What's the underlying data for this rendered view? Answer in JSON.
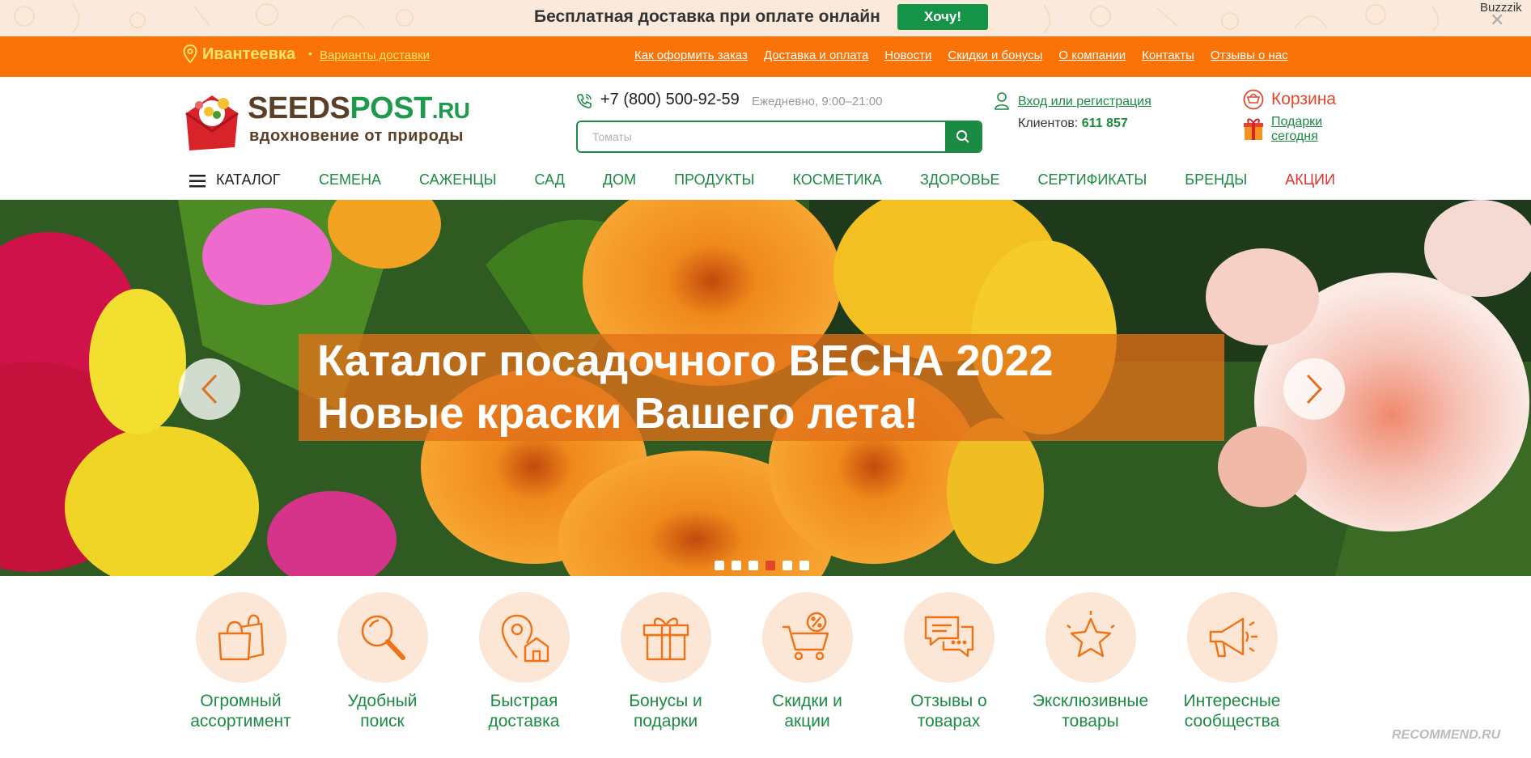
{
  "promo": {
    "text": "Бесплатная доставка при оплате онлайн",
    "button": "Хочу!",
    "corner_label": "Buzzzik"
  },
  "topbar": {
    "city": "Ивантеевка",
    "delivery_link": "Варианты доставки",
    "links": [
      "Как оформить заказ",
      "Доставка и оплата",
      "Новости",
      "Скидки и бонусы",
      "О компании",
      "Контакты",
      "Отзывы о нас"
    ]
  },
  "header": {
    "logo_main": "SEEDS",
    "logo_accent": "POST",
    "logo_tld": ".RU",
    "logo_slogan": "вдохновение от природы",
    "phone": "+7 (800) 500-92-59",
    "hours": "Ежедневно, 9:00–21:00",
    "search_placeholder": "Томаты",
    "login": "Вход или регистрация",
    "clients_label": "Клиентов:",
    "clients_count": "611 857",
    "cart": "Корзина",
    "gifts_line1": "Подарки",
    "gifts_line2": "сегодня"
  },
  "catnav": {
    "catalog": "КАТАЛОГ",
    "items": [
      "СЕМЕНА",
      "САЖЕНЦЫ",
      "САД",
      "ДОМ",
      "ПРОДУКТЫ",
      "КОСМЕТИКА",
      "ЗДОРОВЬЕ",
      "СЕРТИФИКАТЫ",
      "БРЕНДЫ"
    ],
    "sale": "АКЦИИ"
  },
  "hero": {
    "line1": "Каталог посадочного ВЕСНА 2022",
    "line2": "Новые краски Вашего лета!",
    "slide_count": 6,
    "active_slide": 4
  },
  "features": [
    {
      "icon": "shopping-bags-icon",
      "line1": "Огромный",
      "line2": "ассортимент"
    },
    {
      "icon": "magnifier-icon",
      "line1": "Удобный",
      "line2": "поиск"
    },
    {
      "icon": "location-house-icon",
      "line1": "Быстрая",
      "line2": "доставка"
    },
    {
      "icon": "gift-box-icon",
      "line1": "Бонусы и",
      "line2": "подарки"
    },
    {
      "icon": "discount-cart-icon",
      "line1": "Скидки и",
      "line2": "акции"
    },
    {
      "icon": "chat-bubbles-icon",
      "line1": "Отзывы о",
      "line2": "товарах"
    },
    {
      "icon": "star-icon",
      "line1": "Эксклюзивные",
      "line2": "товары"
    },
    {
      "icon": "megaphone-icon",
      "line1": "Интересные",
      "line2": "сообщества"
    }
  ],
  "colors": {
    "orange": "#f97309",
    "green": "#1b8a42",
    "red": "#e2462b",
    "promo_bg": "#fbeadb",
    "icon_bg": "#fce7d6"
  },
  "watermark": "RECOMMEND.RU"
}
